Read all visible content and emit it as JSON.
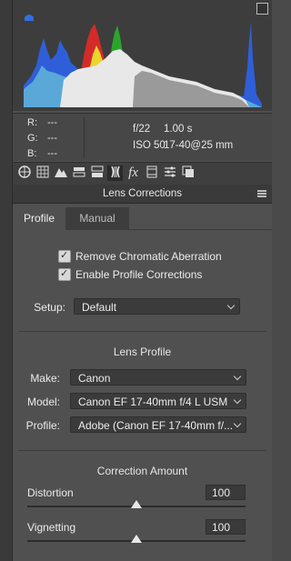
{
  "info": {
    "r_label": "R:",
    "r_value": "---",
    "g_label": "G:",
    "g_value": "---",
    "b_label": "B:",
    "b_value": "---",
    "aperture": "f/22",
    "shutter": "1.00 s",
    "iso": "ISO 50",
    "lens": "17-40@25 mm"
  },
  "toolbar": {
    "icons": [
      "basic-icon",
      "tone-curve-icon",
      "detail-icon",
      "hsl-icon",
      "split-toning-icon",
      "lens-corrections-icon",
      "effects-icon",
      "camera-calibration-icon",
      "presets-icon",
      "snapshots-icon"
    ]
  },
  "panel": {
    "title": "Lens Corrections",
    "tabs": [
      "Profile",
      "Manual"
    ],
    "remove_ca_label": "Remove Chromatic Aberration",
    "enable_profile_label": "Enable Profile Corrections",
    "remove_ca_checked": true,
    "enable_profile_checked": true,
    "setup_label": "Setup:",
    "setup_value": "Default"
  },
  "lens_profile": {
    "title": "Lens Profile",
    "make_label": "Make:",
    "make_value": "Canon",
    "model_label": "Model:",
    "model_value": "Canon EF 17-40mm f/4 L USM",
    "profile_label": "Profile:",
    "profile_value": "Adobe (Canon EF 17-40mm f/..."
  },
  "correction": {
    "title": "Correction Amount",
    "distortion_label": "Distortion",
    "distortion_value": "100",
    "vignetting_label": "Vignetting",
    "vignetting_value": "100"
  },
  "colors": {
    "panel_bg": "#505050",
    "histogram_bg": "#3d3d3d",
    "histogram_blue": "#2f5fd8",
    "histogram_red": "#d42a2a",
    "histogram_green": "#2aa52a",
    "histogram_yellow": "#e8d62a",
    "histogram_white": "#e8e8e8"
  }
}
